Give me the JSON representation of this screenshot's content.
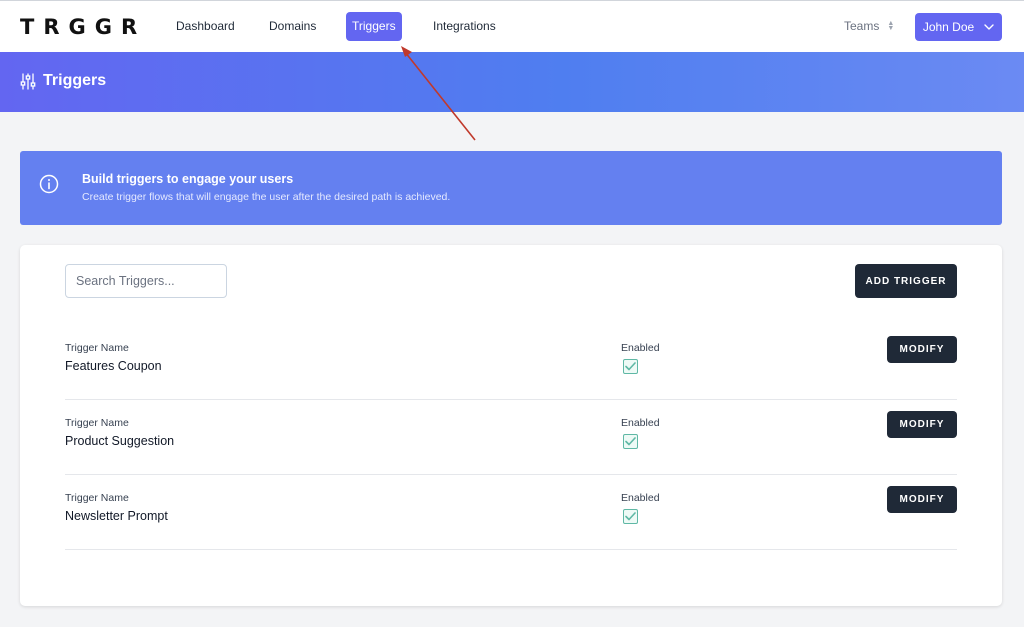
{
  "app": {
    "logo": "TRGGR"
  },
  "nav": {
    "items": [
      {
        "label": "Dashboard"
      },
      {
        "label": "Domains"
      },
      {
        "label": "Triggers"
      },
      {
        "label": "Integrations"
      }
    ],
    "active": "Triggers",
    "teams_label": "Teams",
    "user_name": "John Doe"
  },
  "header": {
    "title": "Triggers",
    "icon": "sliders-icon"
  },
  "info": {
    "title": "Build triggers to engage your users",
    "subtitle": "Create trigger flows that will engage the user after the desired path is achieved.",
    "icon": "info-circle-icon"
  },
  "toolbar": {
    "search_placeholder": "Search Triggers...",
    "search_value": "",
    "add_label": "ADD TRIGGER"
  },
  "triggers": [
    {
      "name_label": "Trigger Name",
      "name": "Features Coupon",
      "enabled_label": "Enabled",
      "enabled": true,
      "action": "MODIFY"
    },
    {
      "name_label": "Trigger Name",
      "name": "Product Suggestion",
      "enabled_label": "Enabled",
      "enabled": true,
      "action": "MODIFY"
    },
    {
      "name_label": "Trigger Name",
      "name": "Newsletter Prompt",
      "enabled_label": "Enabled",
      "enabled": true,
      "action": "MODIFY"
    }
  ],
  "colors": {
    "accent": "#6366f1",
    "dark_button": "#1f2937",
    "banner": "#6480f0",
    "check": "#5fb8a5",
    "annotation_arrow": "#c0392b"
  }
}
